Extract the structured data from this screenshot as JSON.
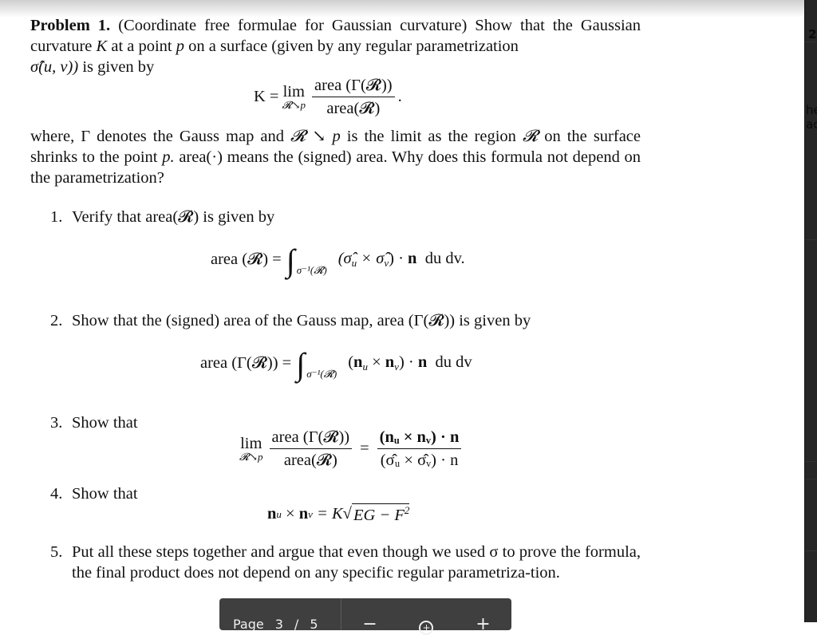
{
  "problem": {
    "label": "Problem 1.",
    "title": "(Coordinate free formulae for Gaussian curvature) Show that the Gaussian curvature",
    "intro_parts": [
      "at a point",
      "on a surface (given by any regular parametrization",
      "is given by"
    ],
    "K": "K",
    "p": "p",
    "sigma_hat": "σ̂(u, v))",
    "main_formula": {
      "lhs": "K =",
      "lim": "lim",
      "lim_sub": "𝓡↘p",
      "numerator": "area (Γ(𝓡))",
      "denominator": "area(𝓡)",
      "end": "."
    },
    "where_text_1": "where, Γ denotes the Gauss map and",
    "where_R": "𝓡 ↘ p",
    "where_text_2": "is the limit as the region",
    "where_R2": "𝓡",
    "where_text_3": "on the surface shrinks to the point",
    "where_p": "p.",
    "where_text_4": "area(·) means the (signed) area. Why does this formula not depend on the parametrization?"
  },
  "items": [
    {
      "num": "1.",
      "text": "Verify that area(𝓡) is given by"
    },
    {
      "num": "2.",
      "text": "Show that the (signed) area of the Gauss map, area (Γ(𝓡)) is given by"
    },
    {
      "num": "3.",
      "text": "Show that"
    },
    {
      "num": "4.",
      "text": "Show that"
    },
    {
      "num": "5.",
      "text": "Put all these steps together and argue that even though we used σ to prove the formula, the final product does not depend on any specific regular parametriza-tion."
    }
  ],
  "eq1": {
    "lhs": "area (𝓡) =",
    "int": "∫",
    "sub": "σ⁻¹(𝓡)",
    "body": "(σ̂",
    "u": "u",
    "x": "× σ̂",
    "v": "v",
    "tail": ") · ",
    "n": "n",
    "end": "  du dv."
  },
  "eq2": {
    "lhs": "area (Γ(𝓡)) =",
    "int": "∫",
    "sub": "σ⁻¹(𝓡)",
    "open": "(",
    "n1": "n",
    "u": "u",
    "x": " × ",
    "n2": "n",
    "v": "v",
    "tail": ") · ",
    "n": "n",
    "end": "  du dv"
  },
  "eq3": {
    "lim": "lim",
    "lim_sub": "𝓡↘p",
    "num_l": "area (Γ(𝓡))",
    "den_l": "area(𝓡)",
    "eq": "=",
    "num_r": "(nᵤ × nᵥ) · n",
    "den_r": "(σ̂ᵤ × σ̂ᵥ) · n"
  },
  "eq4": {
    "lhs_n1": "n",
    "u": "u",
    "x": " × ",
    "lhs_n2": "n",
    "v": "v",
    "eq": " = K",
    "root": "√",
    "rad": "EG − F",
    "pow": "2"
  },
  "sidebar": {
    "page_number": "2",
    "frag1": "he",
    "frag2": "ac"
  },
  "toolbar": {
    "page_label": "Page",
    "current_page": "3",
    "sep": "/",
    "total_pages": "5",
    "zoom_out": "−",
    "zoom_reset": "+",
    "zoom_in": "+"
  }
}
